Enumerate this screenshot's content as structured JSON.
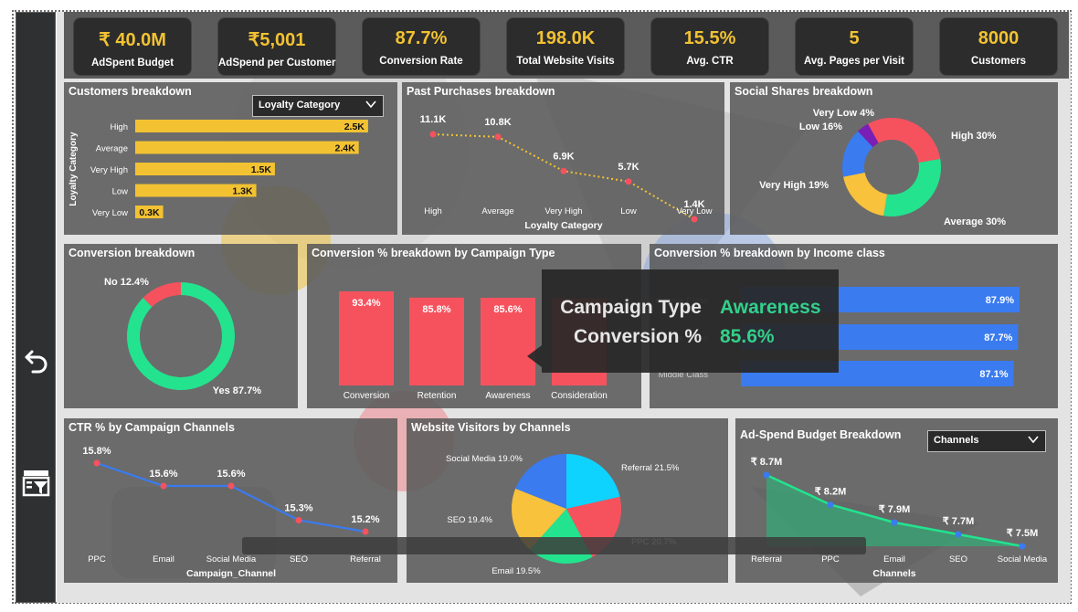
{
  "kpis": [
    {
      "value": "₹ 40.0M",
      "label": "AdSpent Budget"
    },
    {
      "value": "₹5,001",
      "label": "AdSpend per Customer"
    },
    {
      "value": "87.7%",
      "label": "Conversion Rate"
    },
    {
      "value": "198.0K",
      "label": "Total Website Visits"
    },
    {
      "value": "15.5%",
      "label": "Avg. CTR"
    },
    {
      "value": "5",
      "label": "Avg. Pages per Visit"
    },
    {
      "value": "8000",
      "label": "Customers"
    }
  ],
  "panels": {
    "customers": {
      "title": "Customers breakdown",
      "dropdown": "Loyalty Category"
    },
    "past_purchases": {
      "title": "Past Purchases breakdown"
    },
    "social": {
      "title": "Social Shares breakdown"
    },
    "conversion": {
      "title": "Conversion breakdown"
    },
    "campaign": {
      "title": "Conversion % breakdown by Campaign Type"
    },
    "income": {
      "title": "Conversion % breakdown by Income class"
    },
    "ctr": {
      "title": "CTR % by Campaign Channels"
    },
    "visitors": {
      "title": "Website Visitors by Channels"
    },
    "adspend": {
      "title": "Ad-Spend Budget Breakdown",
      "dropdown": "Channels"
    }
  },
  "tooltip": {
    "key1": "Campaign Type",
    "val1": "Awareness",
    "key2": "Conversion %",
    "val2": "85.6%"
  },
  "icons": {
    "back": "back-arrow-icon",
    "filter": "filter-panel-icon",
    "dropdown": "chevron-down-icon"
  },
  "colors": {
    "accent_yellow": "#f2c232",
    "red": "#f6525e",
    "green": "#23e38f",
    "blue": "#3a7bf0",
    "dark": "#2c2c2c"
  },
  "chart_data": [
    {
      "id": "customers",
      "type": "bar",
      "orientation": "horizontal",
      "ylabel": "Loyalty Category",
      "categories": [
        "High",
        "Average",
        "Very High",
        "Low",
        "Very Low"
      ],
      "values": [
        2.5,
        2.4,
        1.5,
        1.3,
        0.3
      ],
      "labels": [
        "2.5K",
        "2.4K",
        "1.5K",
        "1.3K",
        "0.3K"
      ],
      "color": "#f2c232"
    },
    {
      "id": "past_purchases",
      "type": "line",
      "xlabel": "Loyalty Category",
      "categories": [
        "High",
        "Average",
        "Very High",
        "Low",
        "Very Low"
      ],
      "values": [
        11.1,
        10.8,
        6.9,
        5.7,
        1.4
      ],
      "labels": [
        "11.1K",
        "10.8K",
        "6.9K",
        "5.7K",
        "1.4K"
      ]
    },
    {
      "id": "social",
      "type": "pie",
      "donut": true,
      "categories": [
        "High",
        "Average",
        "Very High",
        "Low",
        "Very Low"
      ],
      "values": [
        30,
        30,
        19,
        16,
        4
      ],
      "labels": [
        "High 30%",
        "Average 30%",
        "Very High 19%",
        "Low 16%",
        "Very Low 4%"
      ],
      "colors": [
        "#f6525e",
        "#23e38f",
        "#f9c23c",
        "#3a7bf0",
        "#7a1fb5"
      ]
    },
    {
      "id": "conversion",
      "type": "pie",
      "donut": true,
      "categories": [
        "Yes",
        "No"
      ],
      "values": [
        87.7,
        12.4
      ],
      "labels": [
        "Yes 87.7%",
        "No 12.4%"
      ],
      "colors": [
        "#23e38f",
        "#f6525e"
      ]
    },
    {
      "id": "campaign",
      "type": "bar",
      "categories": [
        "Conversion",
        "Retention",
        "Awareness",
        "Consideration"
      ],
      "values": [
        93.4,
        85.8,
        85.6,
        85.0
      ],
      "labels": [
        "93.4%",
        "85.8%",
        "85.6%",
        ""
      ],
      "color": "#f6525e"
    },
    {
      "id": "income",
      "type": "bar",
      "orientation": "horizontal",
      "categories": [
        "Income Class",
        "Middle Class",
        "Middle Class"
      ],
      "values": [
        87.9,
        87.7,
        87.1
      ],
      "labels": [
        "87.9%",
        "87.7%",
        "87.1%"
      ],
      "color": "#3a7bf0"
    },
    {
      "id": "ctr",
      "type": "line",
      "xlabel": "Campaign_Channel",
      "categories": [
        "PPC",
        "Email",
        "Social Media",
        "SEO",
        "Referral"
      ],
      "values": [
        15.8,
        15.6,
        15.6,
        15.3,
        15.2
      ],
      "labels": [
        "15.8%",
        "15.6%",
        "15.6%",
        "15.3%",
        "15.2%"
      ]
    },
    {
      "id": "visitors",
      "type": "pie",
      "categories": [
        "Referral",
        "PPC",
        "Email",
        "SEO",
        "Social Media"
      ],
      "values": [
        21.5,
        20.7,
        19.5,
        19.4,
        19.0
      ],
      "labels": [
        "Referral 21.5%",
        "PPC 20.7%",
        "Email 19.5%",
        "SEO 19.4%",
        "Social Media 19.0%"
      ],
      "colors": [
        "#0fd3ff",
        "#f6525e",
        "#23e38f",
        "#f9c23c",
        "#3a7bf0"
      ]
    },
    {
      "id": "adspend",
      "type": "area",
      "xlabel": "Channels",
      "categories": [
        "Referral",
        "PPC",
        "Email",
        "SEO",
        "Social Media"
      ],
      "values": [
        8.7,
        8.2,
        7.9,
        7.7,
        7.5
      ],
      "labels": [
        "₹ 8.7M",
        "₹ 8.2M",
        "₹ 7.9M",
        "₹ 7.7M",
        "₹ 7.5M"
      ]
    }
  ]
}
